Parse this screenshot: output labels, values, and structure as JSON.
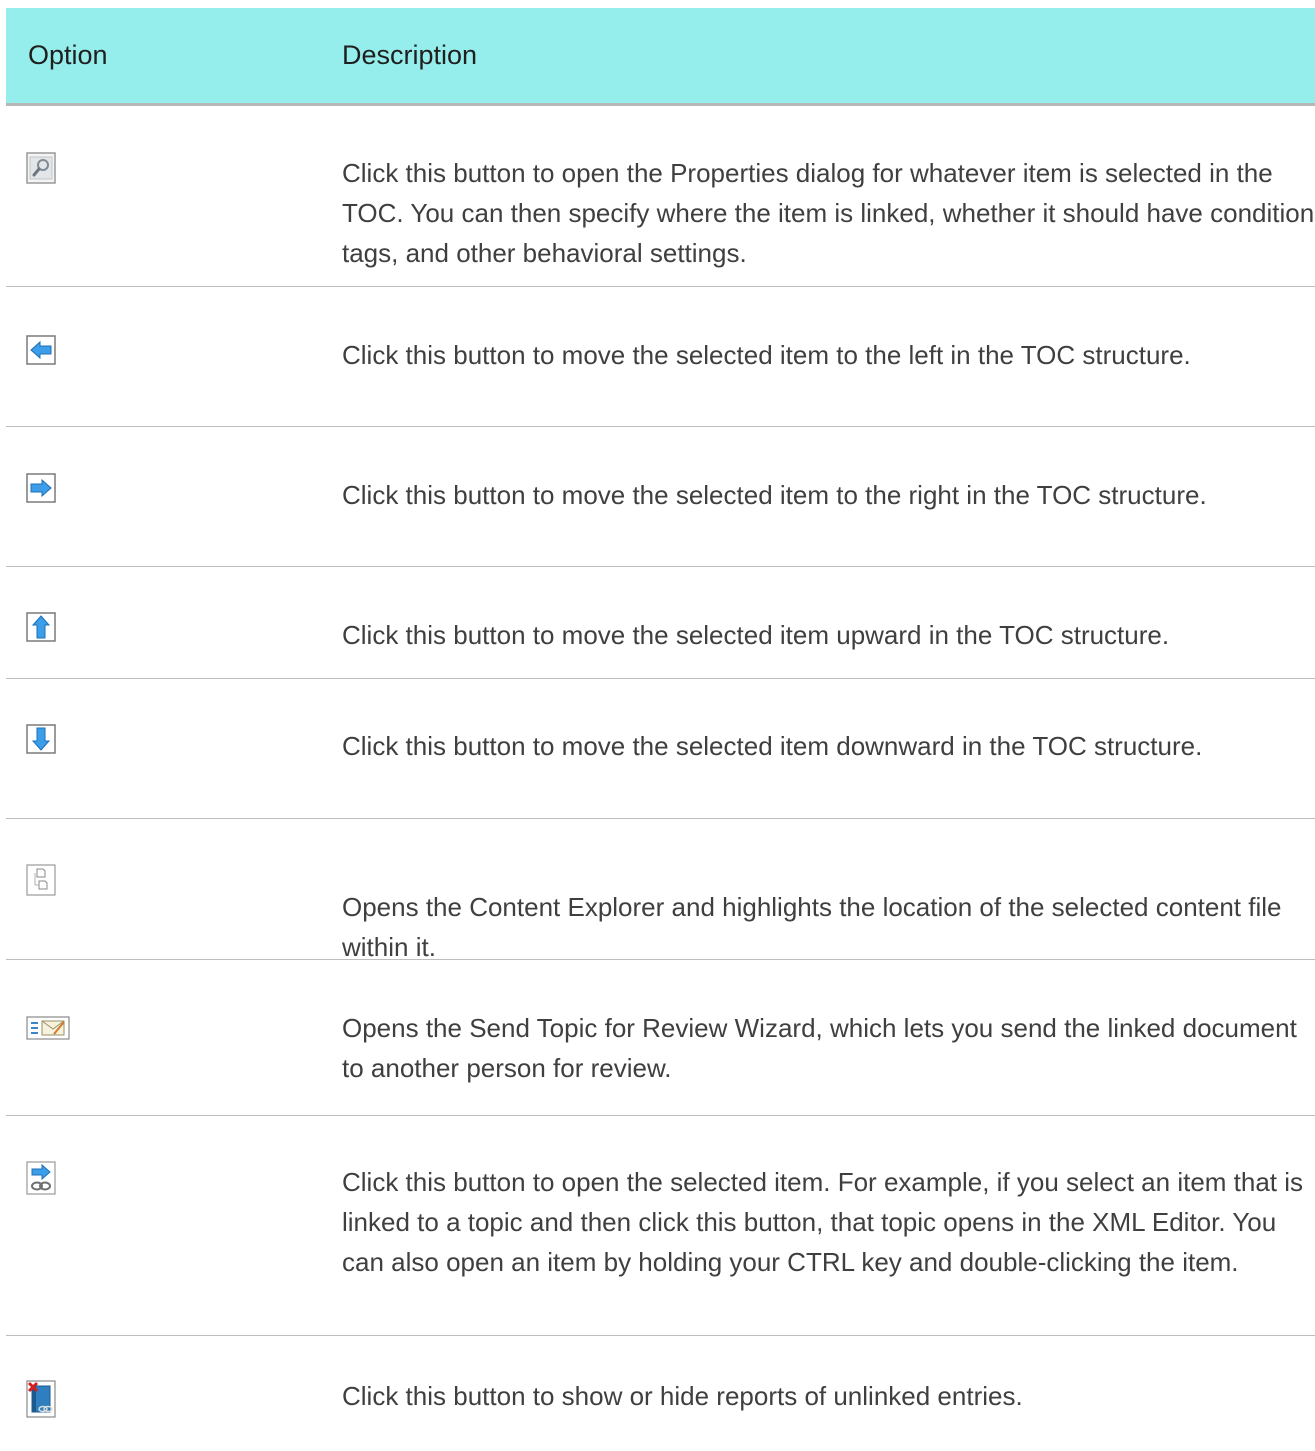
{
  "table": {
    "header": {
      "option": "Option",
      "description": "Description"
    },
    "rows": [
      {
        "icon": "properties-icon",
        "description": "Click this button to open the Properties dialog for whatever item is selected in the TOC. You can then specify where the item is linked, whether it should have condition tags, and other behavioral settings."
      },
      {
        "icon": "move-left-arrow-icon",
        "description": "Click this button to move the selected item to the left in the TOC structure."
      },
      {
        "icon": "move-right-arrow-icon",
        "description": "Click this button to move the selected item to the right in the TOC structure."
      },
      {
        "icon": "move-up-arrow-icon",
        "description": "Click this button to move the selected item upward in the TOC structure."
      },
      {
        "icon": "move-down-arrow-icon",
        "description": "Click this button to move the selected item downward in the TOC structure."
      },
      {
        "icon": "content-explorer-icon",
        "description": "Opens the Content Explorer and highlights the location of the selected content file within it."
      },
      {
        "icon": "send-for-review-icon",
        "description": "Opens the Send Topic for Review Wizard, which lets you send the linked document to another person for review."
      },
      {
        "icon": "open-item-icon",
        "description": "Click this button to open the selected item. For example, if you select an item that is linked to a topic and then click this button, that topic opens in the XML Editor. You can also open an item by holding your CTRL key and double-clicking the item."
      },
      {
        "icon": "unlinked-entries-report-icon",
        "description": "Click this button to show or hide reports of unlinked entries."
      }
    ]
  }
}
